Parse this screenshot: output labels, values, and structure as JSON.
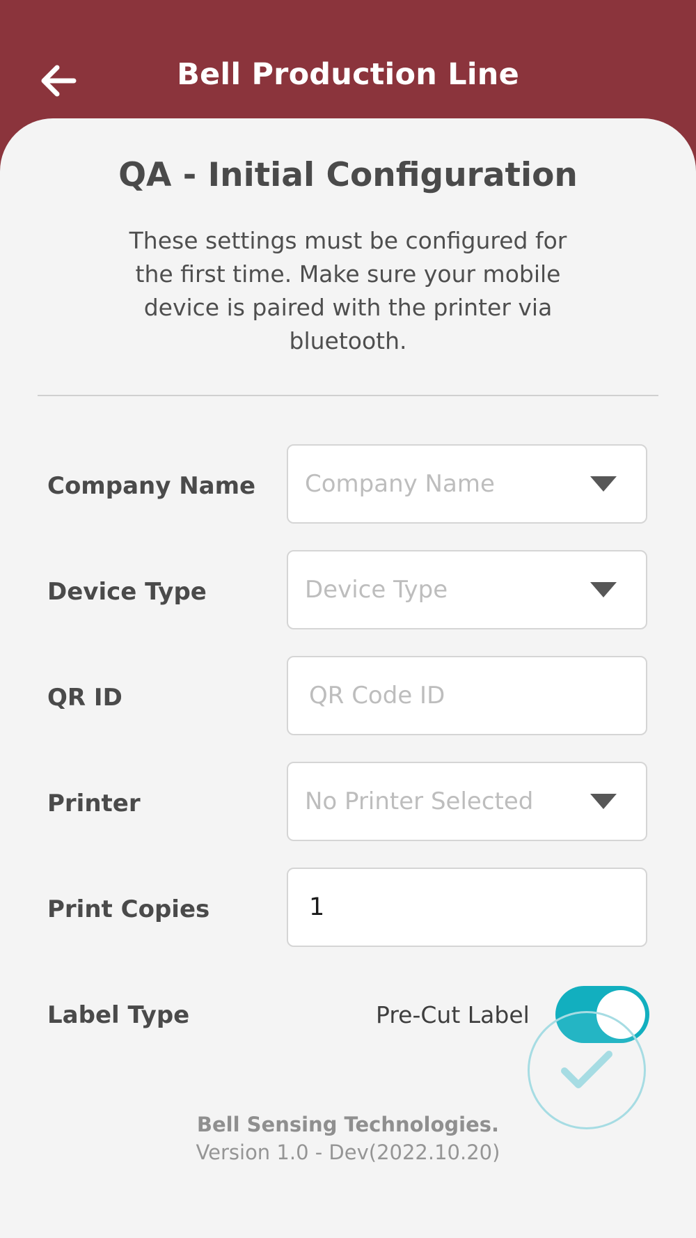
{
  "header": {
    "title": "Bell Production Line",
    "back_icon": "arrow-left-icon"
  },
  "page": {
    "title": "QA - Initial Configuration",
    "description": "These settings must be configured for the first time. Make sure your mobile device is paired with the printer via bluetooth."
  },
  "form": {
    "company": {
      "label": "Company Name",
      "placeholder": "Company Name",
      "value": ""
    },
    "device_type": {
      "label": "Device Type",
      "placeholder": "Device Type",
      "value": ""
    },
    "qr_id": {
      "label": "QR ID",
      "placeholder": "QR Code ID",
      "value": ""
    },
    "printer": {
      "label": "Printer",
      "placeholder": "No Printer Selected",
      "value": ""
    },
    "print_copies": {
      "label": "Print Copies",
      "value": "1"
    },
    "label_type": {
      "label": "Label Type",
      "option_label": "Pre-Cut Label",
      "toggle_on": true
    }
  },
  "fab": {
    "icon": "checkmark-icon"
  },
  "footer": {
    "company": "Bell Sensing Technologies.",
    "version": "Version 1.0 - Dev(2022.10.20)"
  },
  "colors": {
    "brand": "#8B343C",
    "accent": "#12AFBF",
    "background": "#F4F4F4"
  }
}
